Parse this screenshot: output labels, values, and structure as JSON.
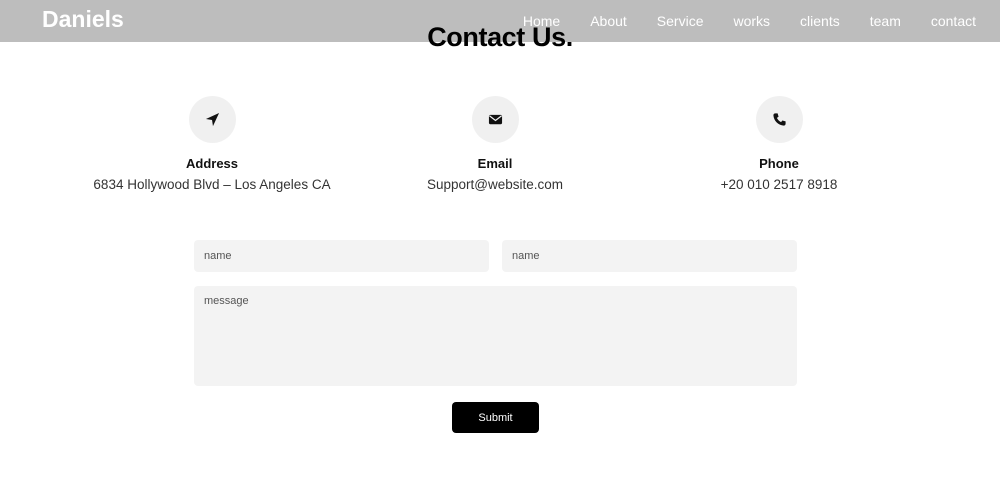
{
  "brand": "Daniels",
  "nav": {
    "items": [
      "Home",
      "About",
      "Service",
      "works",
      "clients",
      "team",
      "contact"
    ]
  },
  "page_title": "Contact Us.",
  "contact_info": [
    {
      "icon": "paper-plane-icon",
      "label": "Address",
      "value": "6834 Hollywood Blvd – Los Angeles CA"
    },
    {
      "icon": "envelope-icon",
      "label": "Email",
      "value": "Support@website.com"
    },
    {
      "icon": "phone-icon",
      "label": "Phone",
      "value": "+20 010 2517 8918"
    }
  ],
  "form": {
    "name_placeholder_1": "name",
    "name_placeholder_2": "name",
    "message_placeholder": "message",
    "submit_label": "Submit"
  },
  "colors": {
    "navbar_bg": "#bdbdbd",
    "icon_circle_bg": "#f0f0f0",
    "field_bg": "#f3f3f3",
    "button_bg": "#000000"
  }
}
